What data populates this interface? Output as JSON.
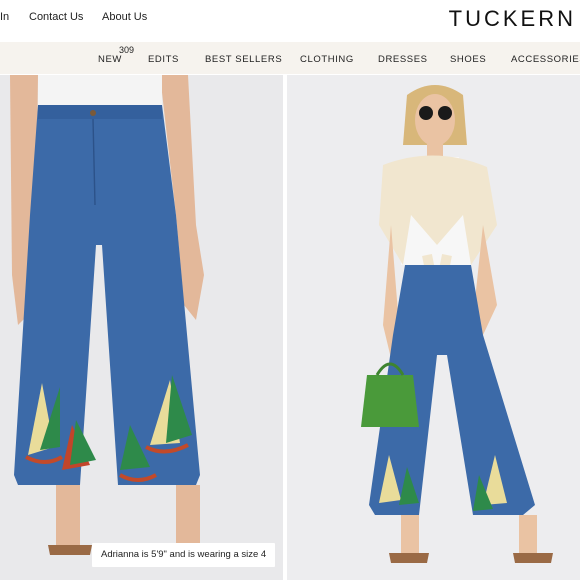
{
  "header": {
    "utility_links": [
      "In",
      "Contact Us",
      "About Us"
    ],
    "brand": "TUCKERN"
  },
  "nav": {
    "items": [
      "NEW",
      "EDITS",
      "BEST SELLERS",
      "CLOTHING",
      "DRESSES",
      "SHOES",
      "ACCESSORIES"
    ],
    "new_badge": "309"
  },
  "gallery": {
    "photo1_alt": "Closeup of blue wide-leg sailboat print pants",
    "photo2_alt": "Model wearing blue sailboat print pants with white top, cream knit sweater and green bag",
    "caption": "Adrianna is 5'9\" and is wearing a size 4"
  },
  "colors": {
    "nav_bg": "#f6f3ee",
    "photo_bg": "#e9e9eb",
    "denim": "#3c6aa8",
    "bag_green": "#4a9a3a"
  }
}
